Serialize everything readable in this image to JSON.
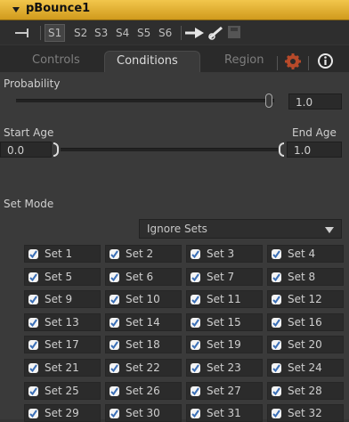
{
  "header": {
    "title": "pBounce1"
  },
  "toolbar": {
    "slots": [
      "S1",
      "S2",
      "S3",
      "S4",
      "S5",
      "S6"
    ],
    "active_slot": "S1"
  },
  "tabs": [
    {
      "label": "Controls",
      "active": false
    },
    {
      "label": "Conditions",
      "active": true
    },
    {
      "label": "Region",
      "active": false
    }
  ],
  "probability": {
    "label": "Probability",
    "value": "1.0",
    "slider_fraction": 1.0
  },
  "age": {
    "start_label": "Start Age",
    "end_label": "End Age",
    "start_value": "0.0",
    "end_value": "1.0"
  },
  "set_mode": {
    "label": "Set Mode",
    "value": "Ignore Sets"
  },
  "sets": [
    {
      "label": "Set 1",
      "checked": true
    },
    {
      "label": "Set 2",
      "checked": true
    },
    {
      "label": "Set 3",
      "checked": true
    },
    {
      "label": "Set 4",
      "checked": true
    },
    {
      "label": "Set 5",
      "checked": true
    },
    {
      "label": "Set 6",
      "checked": true
    },
    {
      "label": "Set 7",
      "checked": true
    },
    {
      "label": "Set 8",
      "checked": true
    },
    {
      "label": "Set 9",
      "checked": true
    },
    {
      "label": "Set 10",
      "checked": true
    },
    {
      "label": "Set 11",
      "checked": true
    },
    {
      "label": "Set 12",
      "checked": true
    },
    {
      "label": "Set 13",
      "checked": true
    },
    {
      "label": "Set 14",
      "checked": true
    },
    {
      "label": "Set 15",
      "checked": true
    },
    {
      "label": "Set 16",
      "checked": true
    },
    {
      "label": "Set 17",
      "checked": true
    },
    {
      "label": "Set 18",
      "checked": true
    },
    {
      "label": "Set 19",
      "checked": true
    },
    {
      "label": "Set 20",
      "checked": true
    },
    {
      "label": "Set 21",
      "checked": true
    },
    {
      "label": "Set 22",
      "checked": true
    },
    {
      "label": "Set 23",
      "checked": true
    },
    {
      "label": "Set 24",
      "checked": true
    },
    {
      "label": "Set 25",
      "checked": true
    },
    {
      "label": "Set 26",
      "checked": true
    },
    {
      "label": "Set 27",
      "checked": true
    },
    {
      "label": "Set 28",
      "checked": true
    },
    {
      "label": "Set 29",
      "checked": true
    },
    {
      "label": "Set 30",
      "checked": true
    },
    {
      "label": "Set 31",
      "checked": true
    },
    {
      "label": "Set 32",
      "checked": true
    }
  ],
  "colors": {
    "header_accent": "#e0a92a",
    "checkbox_check": "#3b6fb6"
  },
  "icons": [
    "collapse-triangle-icon",
    "pin-icon",
    "arrow-right-icon",
    "wand-icon",
    "save-icon",
    "gear-icon",
    "info-icon"
  ]
}
